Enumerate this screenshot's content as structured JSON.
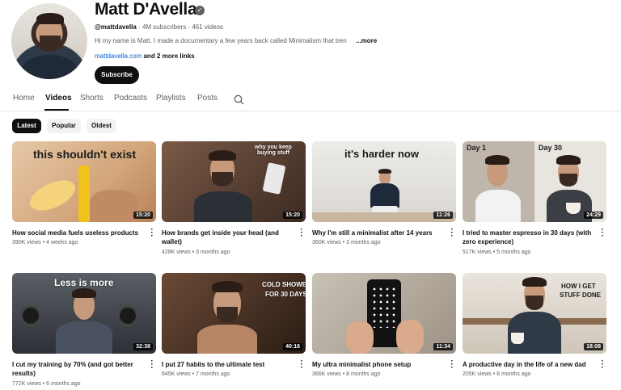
{
  "channel": {
    "name": "Matt D'Avella",
    "handle": "@mattdavella",
    "subscribers": "4M subscribers",
    "video_count": "461 videos",
    "description": "Hi my name is Matt. I made a documentary a few years back called Minimalism that tren",
    "description_more": "...more",
    "link": "mattdavella.com",
    "more_links": "and 2 more links",
    "subscribe_label": "Subscribe",
    "verified_glyph": "✓"
  },
  "tabs": [
    "Home",
    "Videos",
    "Shorts",
    "Podcasts",
    "Playlists",
    "Posts"
  ],
  "active_tab": "Videos",
  "chips": [
    "Latest",
    "Popular",
    "Oldest"
  ],
  "active_chip": "Latest",
  "videos": [
    {
      "title_line1": "How social media fuels useless products",
      "title_line2": "",
      "stats": "390K views • 4 weeks ago",
      "duration": "15:20",
      "thumb_text": "this shouldn't exist"
    },
    {
      "title_line1": "How brands get inside your head (and",
      "title_line2": "wallet)",
      "stats": "428K views • 3 months ago",
      "duration": "15:20",
      "thumb_text": "why you keep buying stuff"
    },
    {
      "title_line1": "Why I'm still a minimalist after 14 years",
      "title_line2": "",
      "stats": "360K views • 3 months ago",
      "duration": "11:26",
      "thumb_text": "it's harder now"
    },
    {
      "title_line1": "I tried to master espresso in 30 days (with",
      "title_line2": "zero experience)",
      "stats": "517K views • 5 months ago",
      "duration": "24:29",
      "thumb_text_a": "Day 1",
      "thumb_text_b": "Day 30"
    },
    {
      "title_line1": "I cut my training by 70% (and got better",
      "title_line2": "results)",
      "stats": "772K views • 6 months ago",
      "duration": "32:38",
      "thumb_text": "Less is more"
    },
    {
      "title_line1": "I put 27 habits to the ultimate test",
      "title_line2": "",
      "stats": "645K views • 7 months ago",
      "duration": "40:16",
      "thumb_text_a": "COLD SHOWERS",
      "thumb_text_b": "FOR 30 DAYS"
    },
    {
      "title_line1": "My ultra minimalist phone setup",
      "title_line2": "",
      "stats": "366K views • 8 months ago",
      "duration": "11:34"
    },
    {
      "title_line1": "A productive day in the life of a new dad",
      "title_line2": "",
      "stats": "205K views • 8 months ago",
      "duration": "18:08",
      "thumb_text_a": "HOW I GET",
      "thumb_text_b": "STUFF DONE"
    }
  ],
  "icons": {
    "search": "search-icon",
    "kebab": "more-vert-icon",
    "verified": "verified-check-icon"
  },
  "colors": {
    "text": "#0f0f0f",
    "secondary": "#606060",
    "link": "#065fd4",
    "accent": "#0f0f0f"
  }
}
